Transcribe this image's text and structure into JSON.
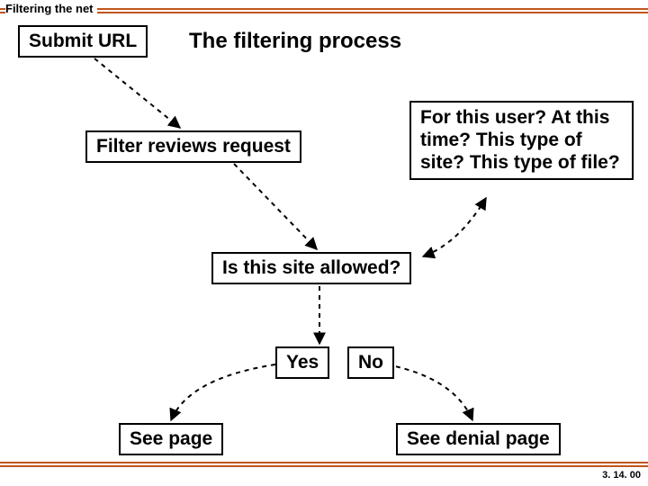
{
  "header": {
    "title": "Filtering the net"
  },
  "footer": {
    "date": "3. 14. 00"
  },
  "slide": {
    "title": "The filtering process"
  },
  "nodes": {
    "submit": "Submit URL",
    "filter_reviews": "Filter reviews request",
    "questions": "For this user?   At this time?  This type of site? This type of file?",
    "allowed": "Is this site allowed?",
    "yes": "Yes",
    "no": "No",
    "see_page": "See page",
    "see_denial": "See denial page"
  },
  "chart_data": {
    "type": "flowchart",
    "title": "The filtering process",
    "nodes": [
      {
        "id": "submit",
        "label": "Submit URL"
      },
      {
        "id": "filter_reviews",
        "label": "Filter reviews request"
      },
      {
        "id": "questions",
        "label": "For this user? At this time? This type of site? This type of file?"
      },
      {
        "id": "allowed",
        "label": "Is this site allowed?"
      },
      {
        "id": "yes",
        "label": "Yes"
      },
      {
        "id": "no",
        "label": "No"
      },
      {
        "id": "see_page",
        "label": "See page"
      },
      {
        "id": "see_denial",
        "label": "See denial page"
      }
    ],
    "edges": [
      {
        "from": "submit",
        "to": "filter_reviews",
        "style": "dashed"
      },
      {
        "from": "filter_reviews",
        "to": "allowed",
        "style": "dashed"
      },
      {
        "from": "questions",
        "to": "allowed",
        "style": "dashed",
        "bidirectional": true
      },
      {
        "from": "allowed",
        "to": "yes",
        "style": "dashed"
      },
      {
        "from": "allowed",
        "to": "no",
        "style": "dashed"
      },
      {
        "from": "yes",
        "to": "see_page",
        "style": "dashed"
      },
      {
        "from": "no",
        "to": "see_denial",
        "style": "dashed"
      }
    ]
  }
}
